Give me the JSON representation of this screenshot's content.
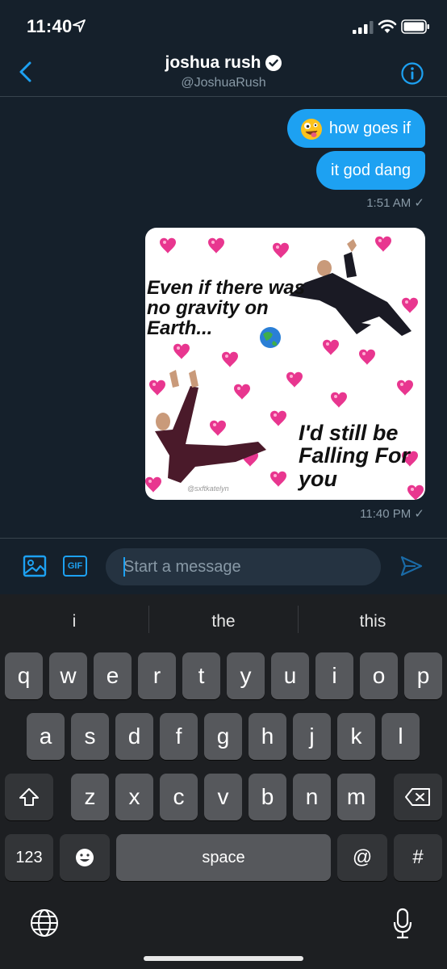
{
  "status_bar": {
    "time": "11:40"
  },
  "header": {
    "name": "joshua rush",
    "handle": "@JoshuaRush"
  },
  "messages": [
    {
      "text": "how goes if",
      "emoji": "zany-face"
    },
    {
      "text": "it god dang"
    }
  ],
  "timestamps": {
    "first": "1:51 AM ✓",
    "second": "11:40 PM ✓"
  },
  "image_message": {
    "top_text": "Even if there was no gravity on Earth...",
    "bottom_text": "I'd still be Falling For you",
    "credit": "@sxftkatelyn"
  },
  "composer": {
    "placeholder": "Start a message",
    "gif_label": "GIF"
  },
  "keyboard": {
    "suggestions": [
      "i",
      "the",
      "this"
    ],
    "row1": [
      "q",
      "w",
      "e",
      "r",
      "t",
      "y",
      "u",
      "i",
      "o",
      "p"
    ],
    "row2": [
      "a",
      "s",
      "d",
      "f",
      "g",
      "h",
      "j",
      "k",
      "l"
    ],
    "row3": [
      "z",
      "x",
      "c",
      "v",
      "b",
      "n",
      "m"
    ],
    "numbers_label": "123",
    "space_label": "space",
    "at_label": "@",
    "hash_label": "#"
  },
  "colors": {
    "accent": "#1da1f2",
    "background": "#15202b",
    "keyboard": "#1d1f22"
  }
}
